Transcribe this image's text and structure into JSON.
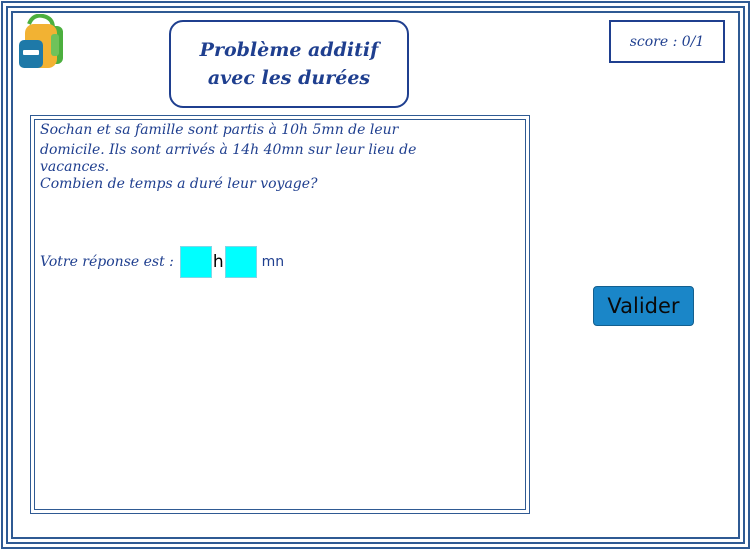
{
  "header": {
    "title_line1": "Problème additif",
    "title_line2": "avec les durées",
    "score": "score : 0/1"
  },
  "question": {
    "line1": "Sochan et sa famille sont partis à 10h 5mn de leur",
    "line2": "domicile. Ils sont arrivés à 14h 40mn sur leur lieu de",
    "line3": "vacances.",
    "line4": "Combien de temps a duré leur voyage?"
  },
  "answer": {
    "label": "Votre réponse est :",
    "hours_value": "",
    "hours_unit": "h",
    "minutes_value": "",
    "minutes_unit": "mn"
  },
  "actions": {
    "submit_label": "Valider"
  },
  "icons": {
    "logo": "backpack-icon"
  },
  "colors": {
    "frame": "#2f5a93",
    "text": "#1f3f8f",
    "input_bg": "#00ffff",
    "button_bg": "#1a86c8"
  }
}
